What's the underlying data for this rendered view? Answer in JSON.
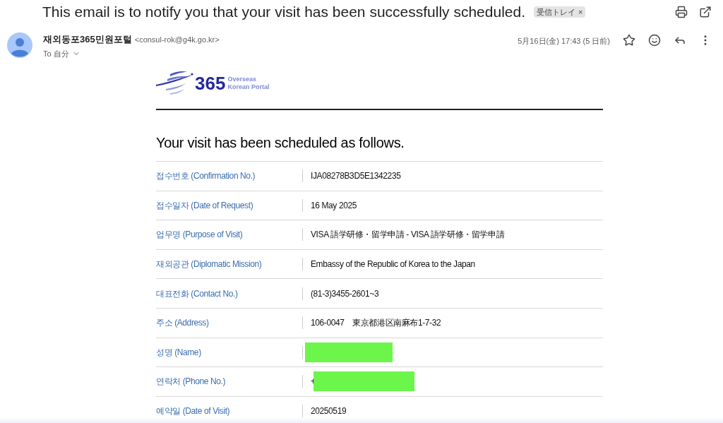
{
  "email": {
    "subject": "This email is to notify you that your visit has been successfully scheduled.",
    "label_chip": "受信トレイ",
    "chip_close": "×",
    "sender_name": "재외동포365민원포털",
    "sender_address": "<consul-rok@g4k.go.kr>",
    "to": "To 自分",
    "date": "5月16日(金) 17:43 (5 日前)"
  },
  "logo": {
    "number": "365",
    "line1": "Overseas",
    "line2": "Korean Portal"
  },
  "heading": "Your visit has been scheduled as follows.",
  "rows": [
    {
      "label": "접수번호 (Confirmation No.)",
      "value": "IJA08278B3D5E1342235",
      "kind": "text"
    },
    {
      "label": "접수일자 (Date of Request)",
      "value": "16 May 2025",
      "kind": "text"
    },
    {
      "label": "업무명 (Purpose of Visit)",
      "value": "VISA 語学研修・留学申請 - VISA 語学研修・留学申請",
      "kind": "text"
    },
    {
      "label": "재외공관 (Diplomatic Mission)",
      "value": "Embassy of the Republic of Korea to the Japan",
      "kind": "text"
    },
    {
      "label": "대표전화 (Contact No.)",
      "value": "(81-3)3455-2601~3",
      "kind": "text"
    },
    {
      "label": "주소 (Address)",
      "value": "106-0047　東京都港区南麻布1-7-32",
      "kind": "text"
    },
    {
      "label": "성명 (Name)",
      "kind": "redacted"
    },
    {
      "label": "연락처 (Phone No.)",
      "value": "+",
      "kind": "redacted"
    },
    {
      "label": "예약일 (Date of Visit)",
      "value": "20250519",
      "kind": "text"
    }
  ]
}
